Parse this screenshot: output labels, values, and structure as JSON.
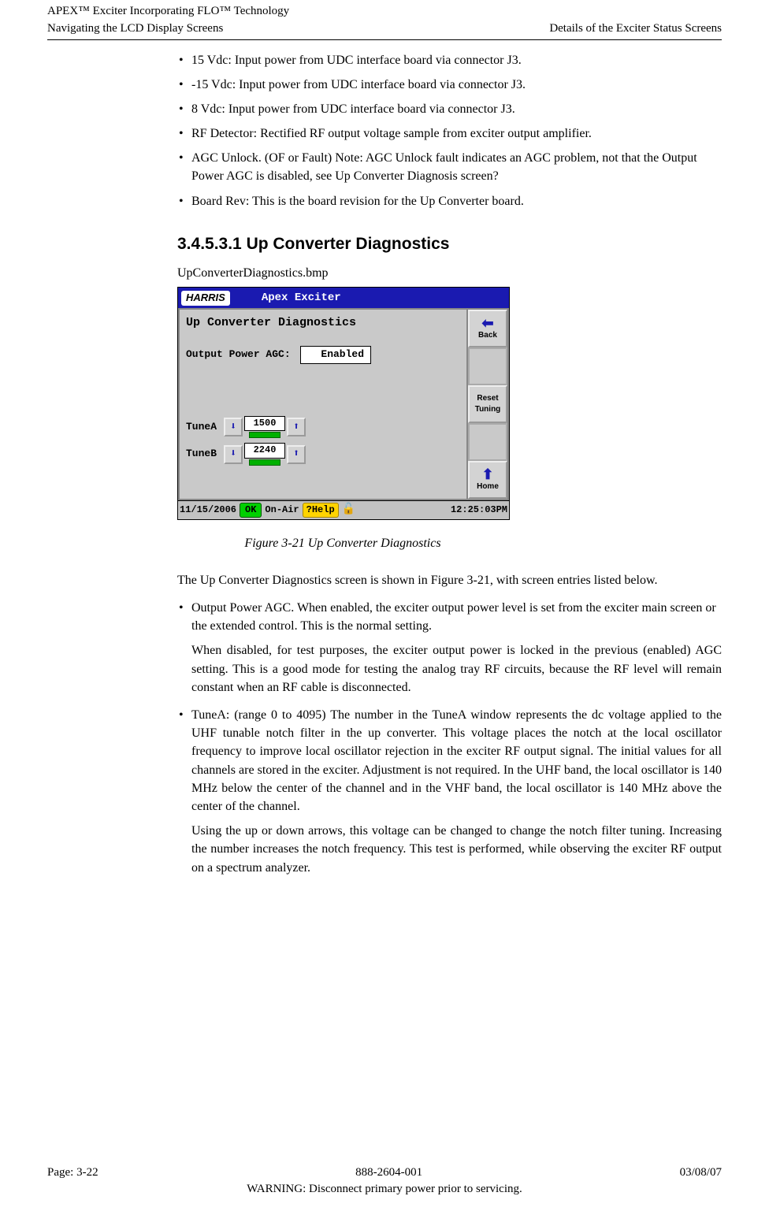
{
  "header": {
    "product_line1": "APEX™ Exciter Incorporating FLO™ Technology",
    "product_line2": "Navigating the LCD Display Screens",
    "right": "Details of the Exciter Status Screens"
  },
  "top_bullets": [
    "15 Vdc: Input power from UDC interface board via connector J3.",
    "-15 Vdc: Input power from UDC interface board via connector J3.",
    "8 Vdc: Input power from UDC interface board via connector J3.",
    "RF Detector: Rectified RF output voltage sample from exciter output amplifier.",
    "AGC Unlock. (OF or Fault) Note: AGC Unlock fault indicates an AGC problem, not that the Output Power AGC is disabled, see Up Converter Diagnosis screen?",
    "Board Rev: This is the board revision for the Up Converter board."
  ],
  "section_heading": "3.4.5.3.1  Up Converter Diagnostics",
  "caption_file": "UpConverterDiagnostics.bmp",
  "lcd": {
    "brand": "HARRIS",
    "title": "Apex Exciter",
    "screen_title": "Up Converter Diagnostics",
    "agc_label": "Output Power AGC:",
    "agc_value": "Enabled",
    "tuneA_label": "TuneA",
    "tuneA_value": "1500",
    "tuneB_label": "TuneB",
    "tuneB_value": "2240",
    "side_back": "Back",
    "side_reset1": "Reset",
    "side_reset2": "Tuning",
    "side_home": "Home",
    "status_date": "11/15/2006",
    "status_ok": "OK",
    "status_onair": "On-Air",
    "status_help": "?Help",
    "status_time": "12:25:03PM"
  },
  "figcaption": "Figure 3-21  Up Converter Diagnostics",
  "para_intro": "The Up Converter Diagnostics screen is shown in Figure 3-21, with screen entries listed below.",
  "bullet_agc": "Output Power AGC. When enabled, the exciter output power level is set from the exciter main screen or the extended control. This is the normal setting.",
  "para_agc_disabled": "When disabled, for test purposes, the exciter output power is locked in the previous (enabled) AGC setting. This is a good mode for testing the analog tray RF circuits, because the RF level will remain constant when an RF cable is disconnected.",
  "bullet_tunea": "TuneA: (range 0 to 4095) The number in the TuneA window represents the dc voltage applied to the UHF tunable notch filter in the up converter. This voltage places the notch at the local oscillator frequency to improve local oscillator rejection in the exciter RF output signal. The initial values for all channels are stored in the exciter. Adjustment is not required. In the UHF band, the local oscillator is 140 MHz below the center of the channel and in the VHF band, the local oscillator is 140 MHz above the center of the channel.",
  "para_tunea_arrows": "Using the up or down arrows, this voltage can be changed to change the notch filter tuning. Increasing the number increases the notch frequency. This test is performed, while observing the exciter RF output on a spectrum analyzer.",
  "footer": {
    "page": "Page: 3-22",
    "docnum": "888-2604-001",
    "date": "03/08/07",
    "warning": "WARNING: Disconnect primary power prior to servicing."
  }
}
